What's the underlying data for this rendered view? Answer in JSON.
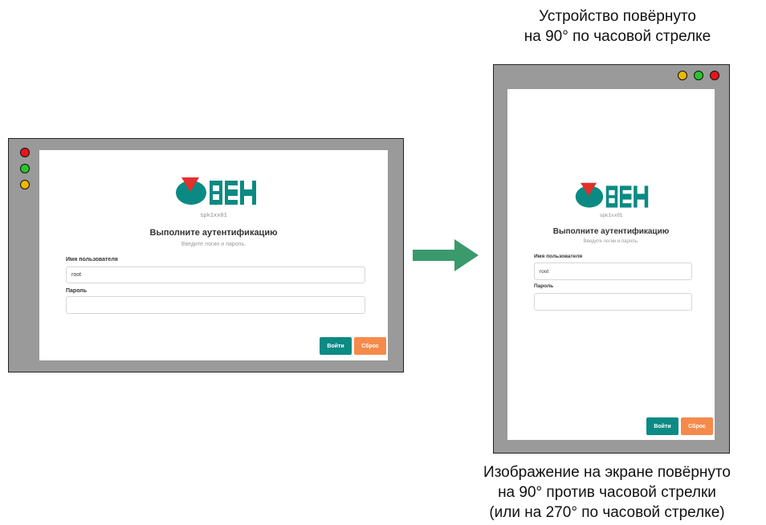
{
  "captions": {
    "top": [
      "Устройство повёрнуто",
      "на 90° по часовой стрелке"
    ],
    "bottom": [
      "Изображение на экране повёрнуто",
      "на 90° против часовой стрелки",
      "(или на 270° по часовой стрелке)"
    ]
  },
  "login": {
    "hostname": "spk1xx01",
    "title": "Выполните аутентификацию",
    "subtitle": "Введите логин и пароль.",
    "username_label": "Имя пользователя",
    "username_value": "root",
    "password_label": "Пароль",
    "password_value": "",
    "login_button": "Войти",
    "reset_button": "Сброс"
  },
  "colors": {
    "device_body": "#9a9a9a",
    "led_red": "#e8141b",
    "led_green": "#2bc42b",
    "led_yellow": "#f2b600",
    "logo_teal": "#0b8a83",
    "logo_red": "#e2302c",
    "login_button": "#0c8a85",
    "reset_button": "#f58a4b",
    "arrow": "#3a9a6c"
  },
  "icons": [
    "oven-logo",
    "led-indicator",
    "arrow-right-icon"
  ]
}
